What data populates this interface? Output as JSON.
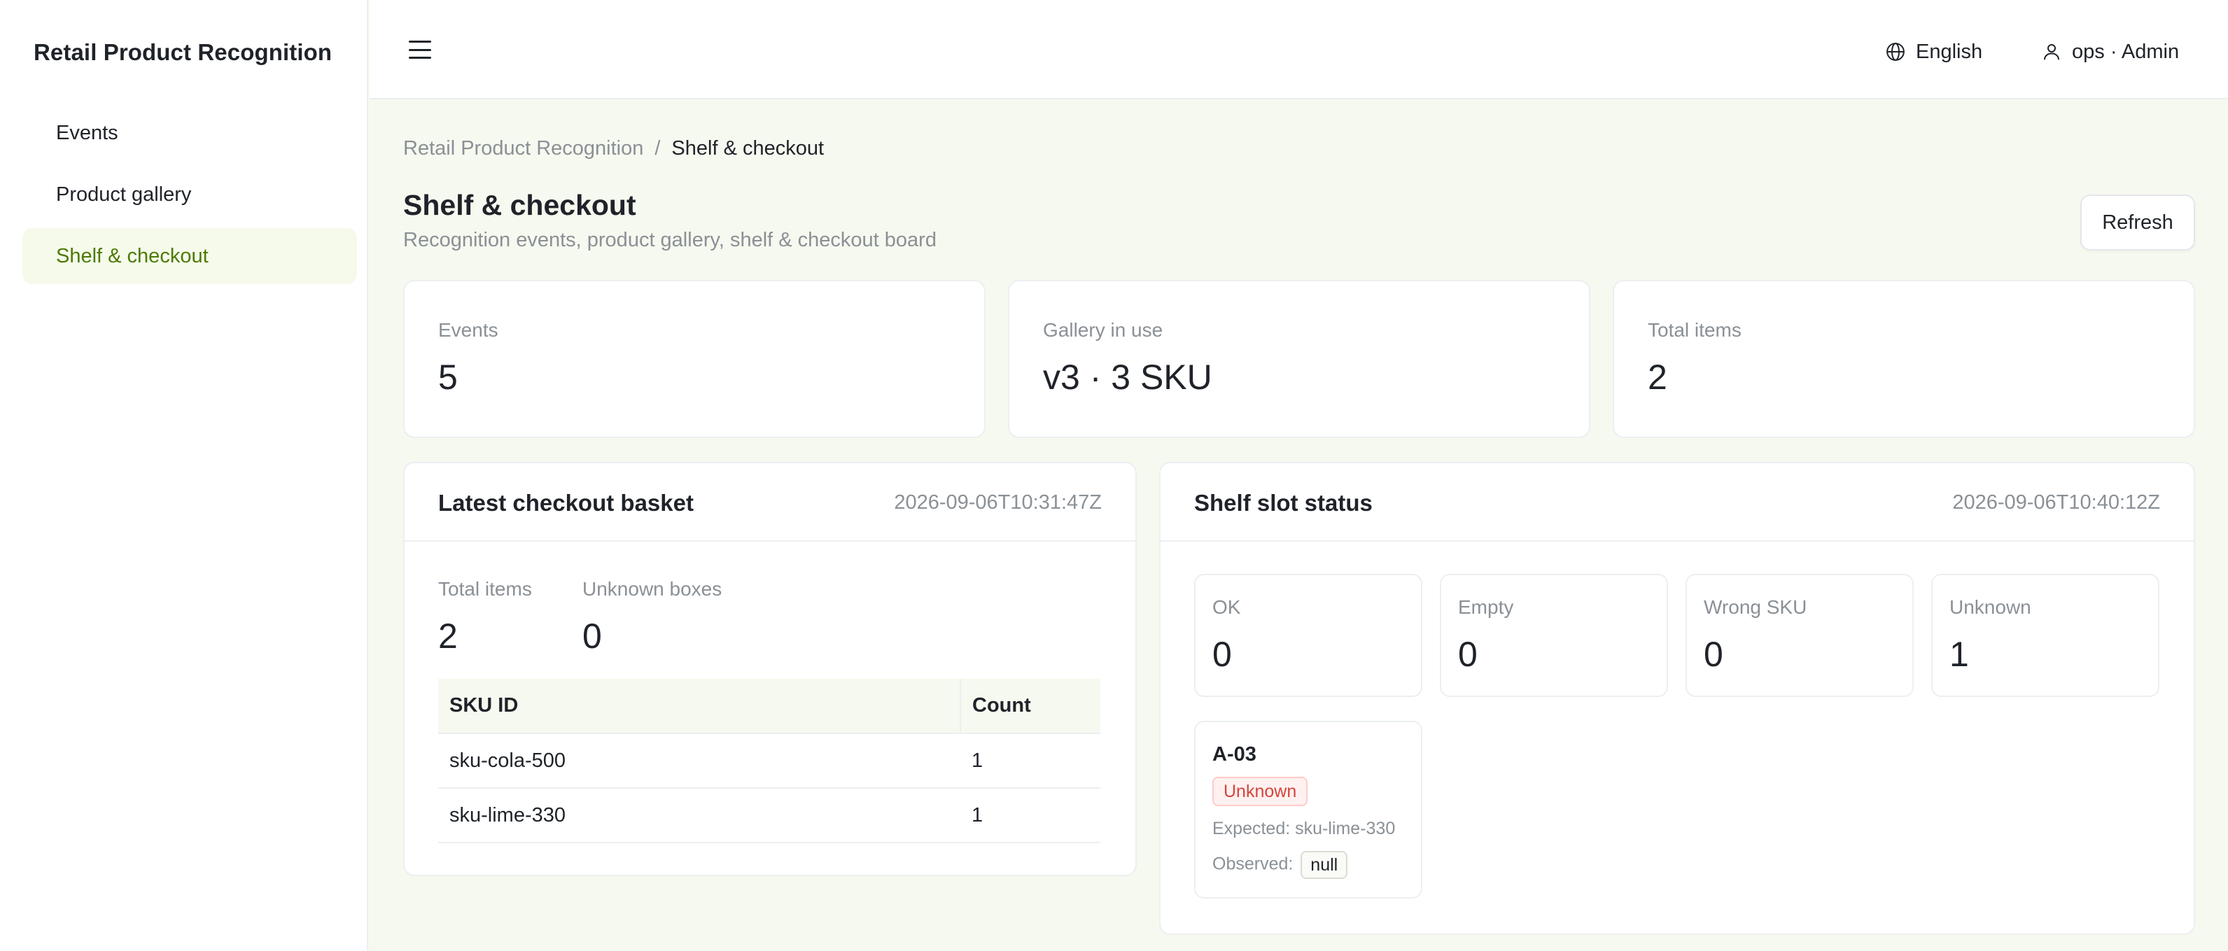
{
  "app": {
    "title": "Retail Product Recognition"
  },
  "sidebar": {
    "items": [
      {
        "label": "Events"
      },
      {
        "label": "Product gallery"
      },
      {
        "label": "Shelf & checkout"
      }
    ]
  },
  "header": {
    "language": "English",
    "user": "ops · Admin"
  },
  "breadcrumb": {
    "root": "Retail Product Recognition",
    "separator": "/",
    "current": "Shelf & checkout"
  },
  "page": {
    "title": "Shelf & checkout",
    "subtitle": "Recognition events, product gallery, shelf & checkout board",
    "refresh_label": "Refresh"
  },
  "stats": [
    {
      "label": "Events",
      "value": "5"
    },
    {
      "label": "Gallery in use",
      "value": "v3 · 3 SKU"
    },
    {
      "label": "Total items",
      "value": "2"
    }
  ],
  "checkout": {
    "title": "Latest checkout basket",
    "timestamp": "2026-09-06T10:31:47Z",
    "total_items_label": "Total items",
    "total_items": "2",
    "unknown_boxes_label": "Unknown boxes",
    "unknown_boxes": "0",
    "columns": [
      "SKU ID",
      "Count"
    ],
    "rows": [
      {
        "sku": "sku-cola-500",
        "count": "1"
      },
      {
        "sku": "sku-lime-330",
        "count": "1"
      }
    ]
  },
  "shelf": {
    "title": "Shelf slot status",
    "timestamp": "2026-09-06T10:40:12Z",
    "counts": [
      {
        "label": "OK",
        "value": "0"
      },
      {
        "label": "Empty",
        "value": "0"
      },
      {
        "label": "Wrong SKU",
        "value": "0"
      },
      {
        "label": "Unknown",
        "value": "1"
      }
    ],
    "slot": {
      "id": "A-03",
      "status": "Unknown",
      "expected_label": "Expected:",
      "expected": "sku-lime-330",
      "observed_label": "Observed:",
      "observed": "null"
    }
  },
  "colors": {
    "accent": "#4d7a00",
    "background": "#f6f9ef",
    "danger": "#d4453b"
  },
  "icons": {
    "menu": "hamburger-icon",
    "language": "globe-icon",
    "user": "user-icon"
  }
}
